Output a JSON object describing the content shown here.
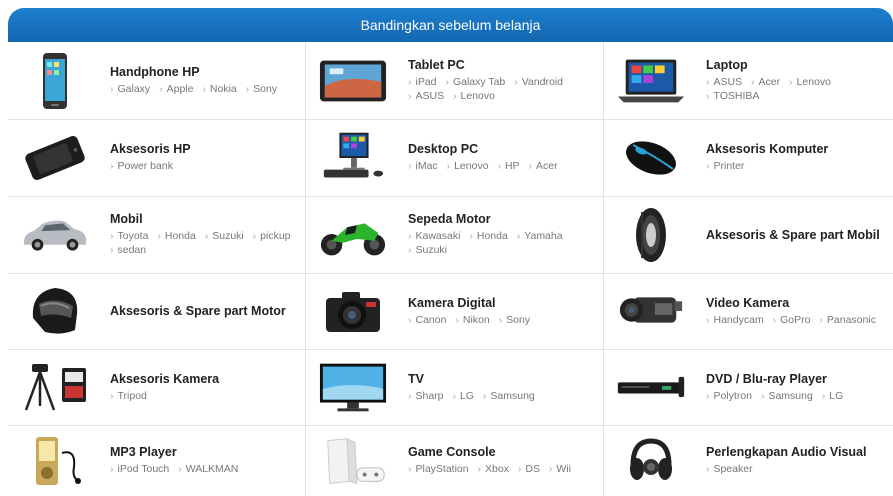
{
  "header": {
    "title": "Bandingkan sebelum belanja"
  },
  "categories": [
    {
      "title": "Handphone HP",
      "subs": [
        "Galaxy",
        "Apple",
        "Nokia",
        "Sony"
      ],
      "icon": "smartphone-icon"
    },
    {
      "title": "Tablet PC",
      "subs": [
        "iPad",
        "Galaxy Tab",
        "Vandroid",
        "ASUS",
        "Lenovo"
      ],
      "icon": "tablet-icon"
    },
    {
      "title": "Laptop",
      "subs": [
        "ASUS",
        "Acer",
        "Lenovo",
        "TOSHIBA"
      ],
      "icon": "laptop-icon"
    },
    {
      "title": "Aksesoris HP",
      "subs": [
        "Power bank"
      ],
      "icon": "phone-case-icon"
    },
    {
      "title": "Desktop PC",
      "subs": [
        "iMac",
        "Lenovo",
        "HP",
        "Acer"
      ],
      "icon": "desktop-icon"
    },
    {
      "title": "Aksesoris Komputer",
      "subs": [
        "Printer"
      ],
      "icon": "mouse-icon"
    },
    {
      "title": "Mobil",
      "subs": [
        "Toyota",
        "Honda",
        "Suzuki",
        "pickup",
        "sedan"
      ],
      "icon": "car-icon"
    },
    {
      "title": "Sepeda Motor",
      "subs": [
        "Kawasaki",
        "Honda",
        "Yamaha",
        "Suzuki"
      ],
      "icon": "motorcycle-icon"
    },
    {
      "title": "Aksesoris & Spare part Mobil",
      "subs": [],
      "icon": "tire-icon"
    },
    {
      "title": "Aksesoris & Spare part Motor",
      "subs": [],
      "icon": "helmet-icon"
    },
    {
      "title": "Kamera Digital",
      "subs": [
        "Canon",
        "Nikon",
        "Sony"
      ],
      "icon": "dslr-camera-icon"
    },
    {
      "title": "Video Kamera",
      "subs": [
        "Handycam",
        "GoPro",
        "Panasonic"
      ],
      "icon": "video-camera-icon"
    },
    {
      "title": "Aksesoris Kamera",
      "subs": [
        "Tripod"
      ],
      "icon": "tripod-icon"
    },
    {
      "title": "TV",
      "subs": [
        "Sharp",
        "LG",
        "Samsung"
      ],
      "icon": "tv-icon"
    },
    {
      "title": "DVD / Blu-ray Player",
      "subs": [
        "Polytron",
        "Samsung",
        "LG"
      ],
      "icon": "dvd-player-icon"
    },
    {
      "title": "MP3 Player",
      "subs": [
        "iPod Touch",
        "WALKMAN"
      ],
      "icon": "mp3-player-icon"
    },
    {
      "title": "Game Console",
      "subs": [
        "PlayStation",
        "Xbox",
        "DS",
        "Wii"
      ],
      "icon": "game-console-icon"
    },
    {
      "title": "Perlengkapan Audio Visual",
      "subs": [
        "Speaker"
      ],
      "icon": "headphones-icon"
    }
  ]
}
